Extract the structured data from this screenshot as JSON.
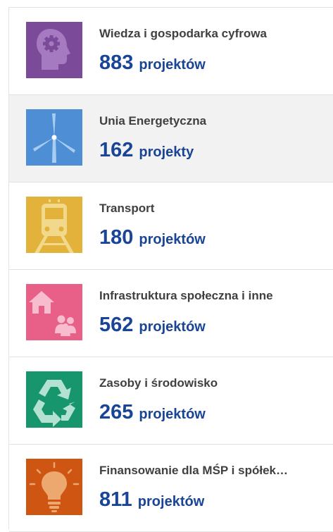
{
  "categories": [
    {
      "title": "Wiedza i gospodarka cyfrowa",
      "count": "883",
      "unit": "projektów",
      "color": "#7b4a98",
      "icon": "head-gear-icon"
    },
    {
      "title": "Unia Energetyczna",
      "count": "162",
      "unit": "projekty",
      "color": "#4d8ed4",
      "icon": "wind-turbine-icon"
    },
    {
      "title": "Transport",
      "count": "180",
      "unit": "projektów",
      "color": "#e2b23a",
      "icon": "train-icon"
    },
    {
      "title": "Infrastruktura społeczna i inne",
      "count": "562",
      "unit": "projektów",
      "color": "#e85f87",
      "icon": "house-people-icon"
    },
    {
      "title": "Zasoby i środowisko",
      "count": "265",
      "unit": "projektów",
      "color": "#17956d",
      "icon": "recycle-icon"
    },
    {
      "title": "Finansowanie dla MŚP i spółek…",
      "count": "811",
      "unit": "projektów",
      "color": "#cf5512",
      "icon": "lightbulb-icon"
    }
  ]
}
